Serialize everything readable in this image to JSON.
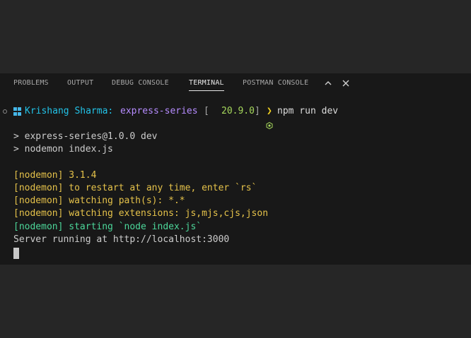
{
  "tabs": [
    {
      "label": "PROBLEMS"
    },
    {
      "label": "OUTPUT"
    },
    {
      "label": "DEBUG CONSOLE"
    },
    {
      "label": "TERMINAL",
      "active": true
    },
    {
      "label": "POSTMAN CONSOLE"
    }
  ],
  "tab_actions": {
    "collapse_icon": "chevron-up-icon",
    "close_icon": "close-icon"
  },
  "prompt": {
    "user": "Krishang Sharma:",
    "directory": "express-series",
    "node_open": "[",
    "node_version": "20.9.0",
    "node_close": "]",
    "arrow": "❯",
    "command": "npm run dev"
  },
  "output": {
    "script_name": "> express-series@1.0.0 dev",
    "script_cmd": "> nodemon index.js",
    "nodemon_version": "[nodemon] 3.1.4",
    "nodemon_restart": "[nodemon] to restart at any time, enter `rs`",
    "nodemon_watch": "[nodemon] watching path(s): *.*",
    "nodemon_ext": "[nodemon] watching extensions: js,mjs,cjs,json",
    "nodemon_start": "[nodemon] starting `node index.js`",
    "server": "Server running at http://localhost:3000"
  },
  "colors": {
    "panel_bg": "#181818",
    "page_bg": "#262626",
    "user": "#22c3e8",
    "directory": "#b68cff",
    "node_version": "#a6d85c",
    "nodemon_yellow": "#e5c24a",
    "nodemon_green": "#4cd79a"
  }
}
